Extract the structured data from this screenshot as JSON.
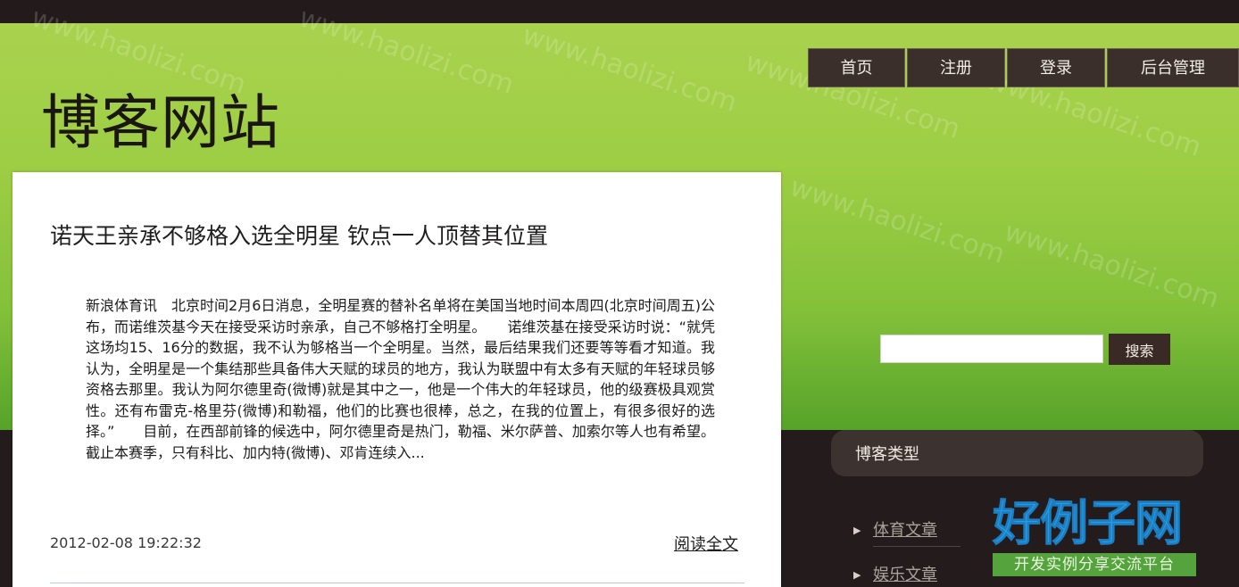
{
  "site": {
    "title": "博客网站"
  },
  "nav": {
    "items": [
      {
        "label": "首页"
      },
      {
        "label": "注册"
      },
      {
        "label": "登录"
      },
      {
        "label": "后台管理"
      }
    ]
  },
  "search": {
    "value": "",
    "placeholder": "",
    "button_label": "搜索"
  },
  "article": {
    "title": "诺天王亲承不够格入选全明星 钦点一人顶替其位置",
    "body": "新浪体育讯　北京时间2月6日消息，全明星赛的替补名单将在美国当地时间本周四(北京时间周五)公布，而诺维茨基今天在接受采访时亲承，自己不够格打全明星。　　诺维茨基在接受采访时说：“就凭这场均15、16分的数据，我不认为够格当一个全明星。当然，最后结果我们还要等等看才知道。我认为，全明星是一个集结那些具备伟大天赋的球员的地方，我认为联盟中有太多有天赋的年轻球员够资格去那里。我认为阿尔德里奇(微博)就是其中之一，他是一个伟大的年轻球员，他的级赛极具观赏性。还有布雷克-格里芬(微博)和勒福，他们的比赛也很棒，总之，在我的位置上，有很多很好的选择。”　　目前，在西部前锋的候选中，阿尔德里奇是热门，勒福、米尔萨普、加索尔等人也有希望。截止本赛季，只有科比、加内特(微博)、邓肯连续入...",
    "date": "2012-02-08 19:22:32",
    "read_more": "阅读全文"
  },
  "sidebar": {
    "heading": "博客类型",
    "categories": [
      {
        "label": "体育文章"
      },
      {
        "label": "娱乐文章"
      }
    ]
  },
  "watermark": {
    "text": "www.haolizi.com",
    "logo_main": "好例子网",
    "logo_sub": "开发实例分享交流平台"
  },
  "colors": {
    "header_green": "#9dce44",
    "nav_bg": "#3a2f2b",
    "dark_bg": "#241c1c",
    "logo_blue": "#2a9be0",
    "logo_green": "#55a33c"
  },
  "icons": {
    "category_bullet": "arrow-right-icon"
  }
}
